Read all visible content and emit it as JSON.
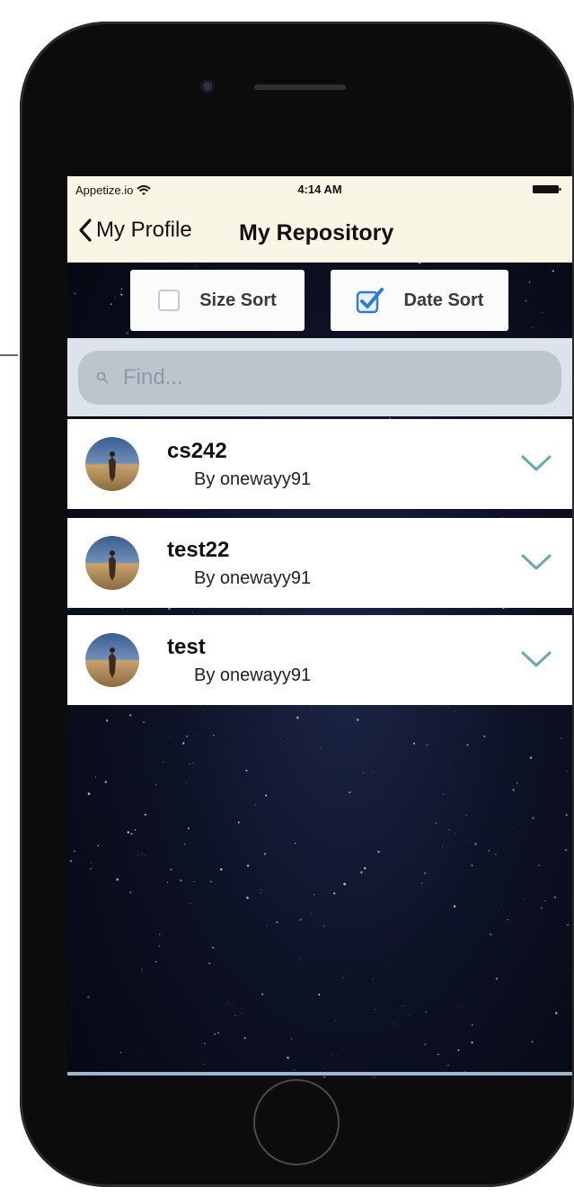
{
  "status_bar": {
    "carrier": "Appetize.io",
    "time": "4:14 AM"
  },
  "nav": {
    "back_label": "My Profile",
    "title": "My Repository"
  },
  "sort": {
    "size_label": "Size Sort",
    "size_checked": false,
    "date_label": "Date Sort",
    "date_checked": true
  },
  "search": {
    "placeholder": "Find...",
    "value": ""
  },
  "repositories": [
    {
      "name": "cs242",
      "owner": "By onewayy91"
    },
    {
      "name": "test22",
      "owner": "By onewayy91"
    },
    {
      "name": "test",
      "owner": "By onewayy91"
    }
  ],
  "colors": {
    "nav_background": "#faf6e6",
    "checkbox_accent": "#2f7dd1",
    "chevron_accent": "#6aa8b5"
  },
  "icons": [
    "wifi-icon",
    "battery-icon",
    "chevron-left-icon",
    "checkbox-icon",
    "search-icon",
    "avatar",
    "chevron-down-icon"
  ]
}
